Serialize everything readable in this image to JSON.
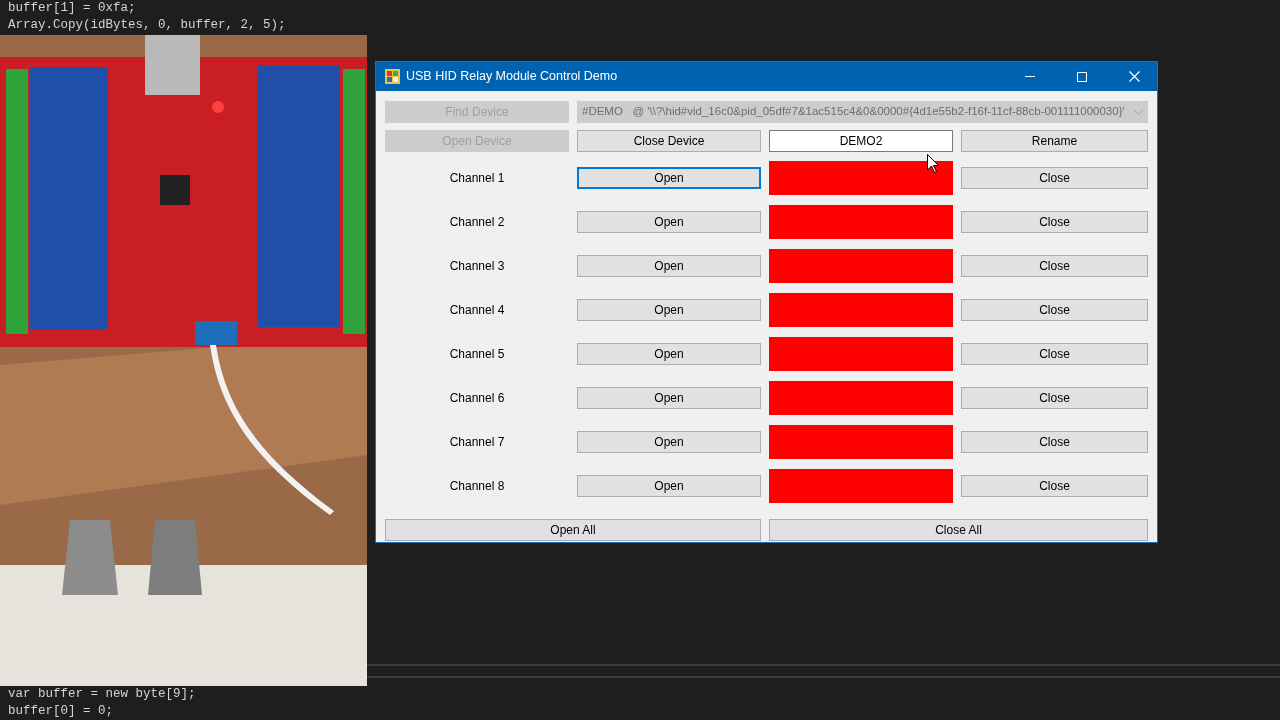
{
  "editor": {
    "lines_top": [
      "buffer[1] = 0xfa;",
      "Array.Copy(idBytes, 0, buffer, 2, 5);"
    ],
    "lines_bottom": [
      "var buffer = new byte[9];",
      "buffer[0] = 0;"
    ]
  },
  "window": {
    "title": "USB HID Relay Module Control Demo",
    "find_button": {
      "label": "Find Device",
      "disabled": true
    },
    "device_select": {
      "value": "#DEMO   @ '\\\\?\\hid#vid_16c0&pid_05df#7&1ac515c4&0&0000#{4d1e55b2-f16f-11cf-88cb-001111000030}'",
      "disabled": true
    },
    "open_button": {
      "label": "Open Device",
      "disabled": true
    },
    "close_button": {
      "label": "Close Device",
      "disabled": false
    },
    "name_field": {
      "value": "DEMO2"
    },
    "rename_button": {
      "label": "Rename",
      "disabled": false
    },
    "channels": [
      {
        "name": "Channel 1",
        "open": "Open",
        "close": "Close",
        "on": false,
        "focused": true
      },
      {
        "name": "Channel 2",
        "open": "Open",
        "close": "Close",
        "on": false,
        "focused": false
      },
      {
        "name": "Channel 3",
        "open": "Open",
        "close": "Close",
        "on": false,
        "focused": false
      },
      {
        "name": "Channel 4",
        "open": "Open",
        "close": "Close",
        "on": false,
        "focused": false
      },
      {
        "name": "Channel 5",
        "open": "Open",
        "close": "Close",
        "on": false,
        "focused": false
      },
      {
        "name": "Channel 6",
        "open": "Open",
        "close": "Close",
        "on": false,
        "focused": false
      },
      {
        "name": "Channel 7",
        "open": "Open",
        "close": "Close",
        "on": false,
        "focused": false
      },
      {
        "name": "Channel 8",
        "open": "Open",
        "close": "Close",
        "on": false,
        "focused": false
      }
    ],
    "open_all": {
      "label": "Open All"
    },
    "close_all": {
      "label": "Close All"
    }
  }
}
